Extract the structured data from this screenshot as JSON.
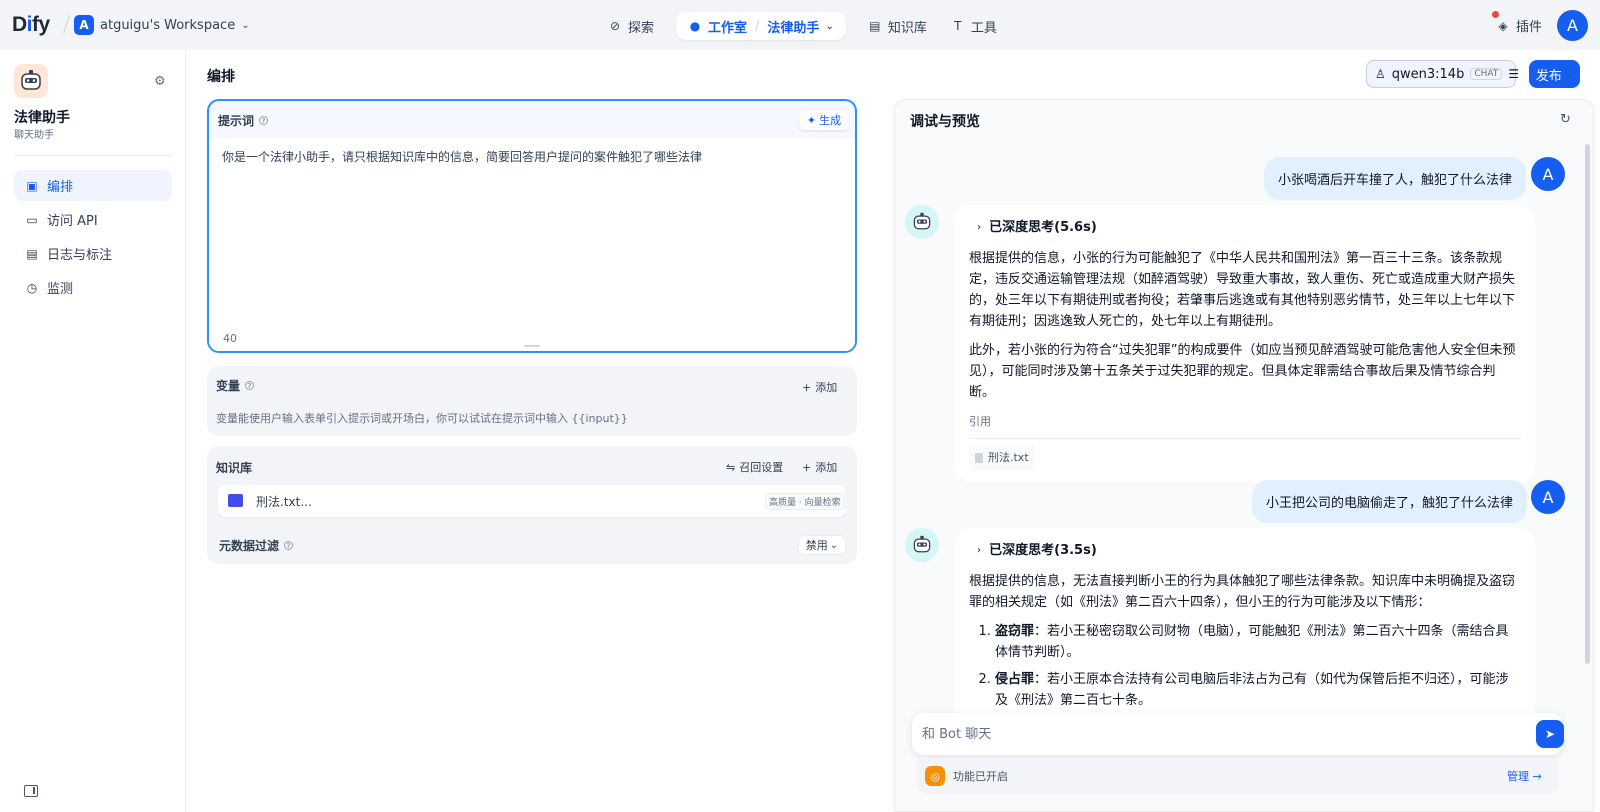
{
  "topbar": {
    "logo_main": "D",
    "logo_i": "i",
    "logo_rest": "fy",
    "workspace_initial": "A",
    "workspace_name": "atguigu's Workspace",
    "nav": {
      "explore": "探索",
      "studio": "工作室",
      "app_name": "法律助手",
      "knowledge": "知识库",
      "tools": "工具"
    },
    "plugins": "插件",
    "user_initial": "A"
  },
  "sidebar": {
    "app_name": "法律助手",
    "app_type": "聊天助手",
    "items": [
      {
        "label": "编排",
        "icon": "layout-icon"
      },
      {
        "label": "访问 API",
        "icon": "terminal-icon"
      },
      {
        "label": "日志与标注",
        "icon": "file-icon"
      },
      {
        "label": "监测",
        "icon": "gauge-icon"
      }
    ]
  },
  "main": {
    "title": "编排",
    "model": {
      "name": "qwen3:14b",
      "tag": "CHAT"
    },
    "publish": "发布",
    "prompt": {
      "title": "提示词",
      "generate": "生成",
      "text": "你是一个法律小助手，请只根据知识库中的信息，简要回答用户提问的案件触犯了哪些法律",
      "count": "40"
    },
    "variables": {
      "title": "变量",
      "add": "添加",
      "hint": "变量能使用户输入表单引入提示词或开场白，你可以试试在提示词中输入 {{input}}"
    },
    "knowledge": {
      "title": "知识库",
      "recall": "召回设置",
      "add": "添加",
      "item_name": "刑法.txt...",
      "item_tag": "高质量 · 向量检索",
      "meta_filter": "元数据过滤",
      "meta_value": "禁用"
    }
  },
  "preview": {
    "title": "调试与预览",
    "user_initial": "A",
    "messages": {
      "q1": "小张喝酒后开车撞了人，触犯了什么法律",
      "a1_think": "已深度思考(5.6s)",
      "a1_p1": "根据提供的信息，小张的行为可能触犯了《中华人民共和国刑法》第一百三十三条。该条款规定，违反交通运输管理法规（如醉酒驾驶）导致重大事故，致人重伤、死亡或造成重大财产损失的，处三年以下有期徒刑或者拘役；若肇事后逃逸或有其他特别恶劣情节，处三年以上七年以下有期徒刑；因逃逸致人死亡的，处七年以上有期徒刑。",
      "a1_p2": "此外，若小张的行为符合“过失犯罪”的构成要件（如应当预见醉酒驾驶可能危害他人安全但未预见），可能同时涉及第十五条关于过失犯罪的规定。但具体定罪需结合事故后果及情节综合判断。",
      "a1_cite_label": "引用",
      "a1_cite_file": "刑法.txt",
      "q2": "小王把公司的电脑偷走了，触犯了什么法律",
      "a2_think": "已深度思考(3.5s)",
      "a2_p1": "根据提供的信息，无法直接判断小王的行为具体触犯了哪些法律条款。知识库中未明确提及盗窃罪的相关规定（如《刑法》第二百六十四条），但小王的行为可能涉及以下情形：",
      "a2_li1_b": "盗窃罪",
      "a2_li1": "：若小王秘密窃取公司财物（电脑），可能触犯《刑法》第二百六十四条（需结合具体情节判断）。",
      "a2_li2_b": "侵占罪",
      "a2_li2": "：若小王原本合法持有公司电脑后非法占为己有（如代为保管后拒不归还），可能涉及《刑法》第二百七十条。"
    },
    "input_placeholder": "和 Bot 聊天",
    "feature_text": "功能已开启",
    "manage": "管理 →"
  }
}
